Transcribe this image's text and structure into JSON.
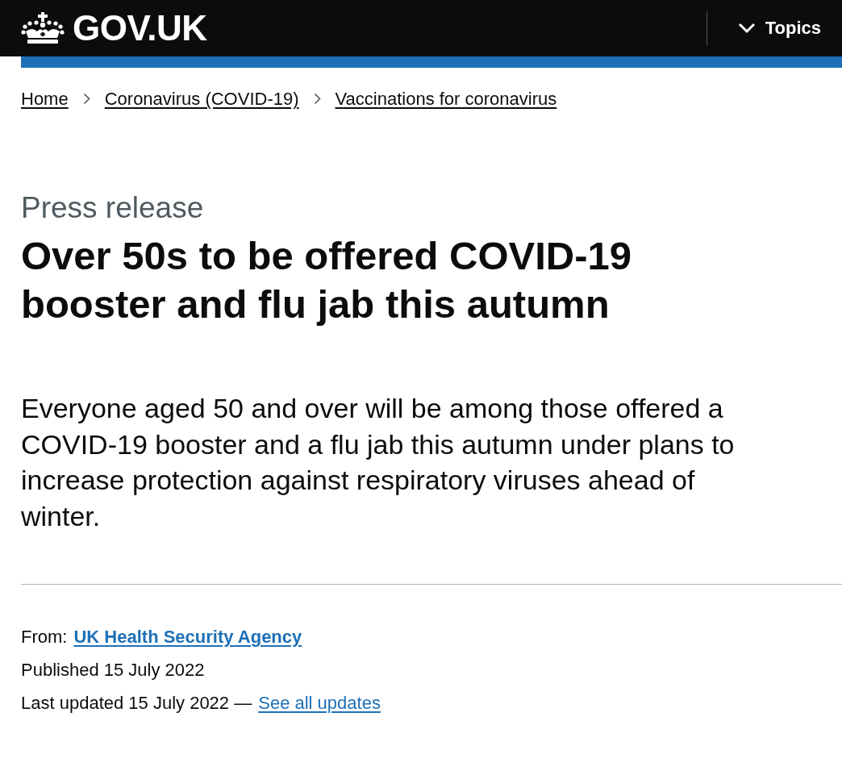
{
  "header": {
    "logo": "GOV.UK",
    "menu_button": "Topics"
  },
  "breadcrumbs": [
    "Home",
    "Coronavirus (COVID-19)",
    "Vaccinations for coronavirus"
  ],
  "article": {
    "type_label": "Press release",
    "title": "Over 50s to be offered COVID-19 booster and flu jab this autumn",
    "lead": "Everyone aged 50 and over will be among those offered a COVID-19 booster and a flu jab this autumn under plans to increase protection against respiratory viruses ahead of winter."
  },
  "metadata": {
    "from_label": "From:",
    "from_link": "UK Health Security Agency",
    "published": "Published 15 July 2022",
    "last_updated": "Last updated 15 July 2022 —",
    "updates_link": "See all updates"
  }
}
